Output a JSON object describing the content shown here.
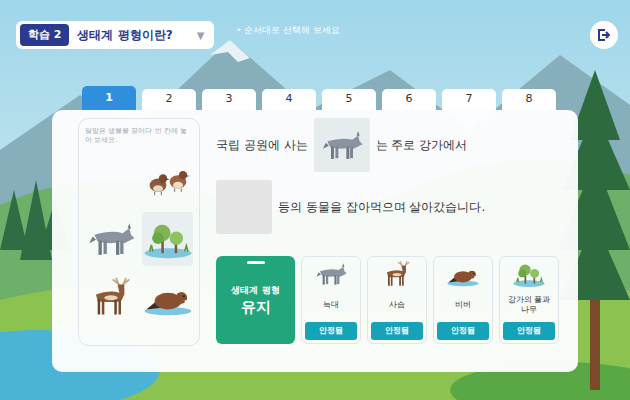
{
  "header": {
    "badge": "학습 2",
    "title": "생태계 평형이란?",
    "dropdown": "▼",
    "instruction": "• 순서대로 선택해 보세요"
  },
  "tabs": [
    {
      "label": "1",
      "selected": true
    },
    {
      "label": "2",
      "selected": false
    },
    {
      "label": "3",
      "selected": false
    },
    {
      "label": "4",
      "selected": false
    },
    {
      "label": "5",
      "selected": false
    },
    {
      "label": "6",
      "selected": false
    },
    {
      "label": "7",
      "selected": false
    },
    {
      "label": "8",
      "selected": false
    }
  ],
  "organism_panel": {
    "hint": "알맞은 생물을 끌어다 빈 칸에 놓아 보세요.",
    "items": [
      {
        "kind": "birds",
        "selected": false
      },
      {
        "kind": "wolf",
        "selected": false
      },
      {
        "kind": "plants",
        "selected": true
      },
      {
        "kind": "deer",
        "selected": false
      },
      {
        "kind": "beaver",
        "selected": false
      }
    ]
  },
  "sentence": {
    "lines": [
      [
        {
          "kind": "text",
          "text": "국립 공원에 사는"
        },
        {
          "kind": "slot",
          "filled": true,
          "animal": "wolf"
        },
        {
          "kind": "text",
          "text": "는 주로 강가에서"
        }
      ],
      [
        {
          "kind": "slot",
          "filled": false
        },
        {
          "kind": "text",
          "text": "등의 동물을 잡아먹으며 살아갔습니다."
        }
      ]
    ]
  },
  "balance": {
    "label": "생태계 평형",
    "state": "유지"
  },
  "species": [
    {
      "name": "늑대",
      "kind": "wolf",
      "status": "안정됨"
    },
    {
      "name": "사슴",
      "kind": "deer",
      "status": "안정됨"
    },
    {
      "name": "비버",
      "kind": "beaver",
      "status": "안정됨"
    },
    {
      "name": "강가의 풀과 나무",
      "kind": "plants",
      "status": "안정됨"
    }
  ]
}
